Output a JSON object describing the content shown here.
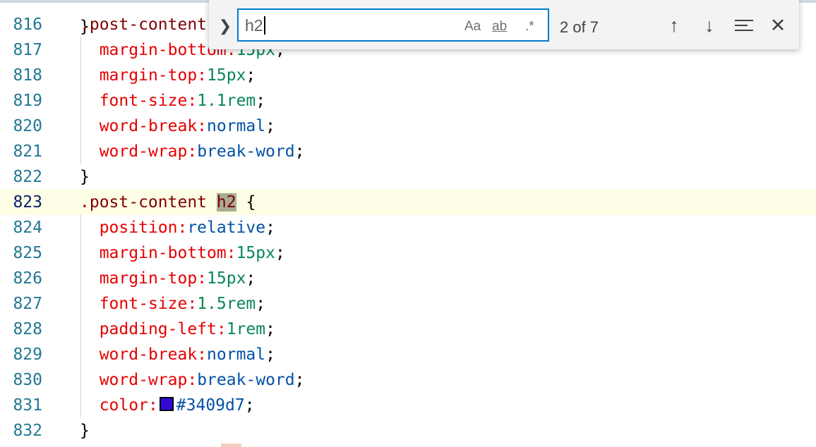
{
  "find_widget": {
    "toggle_icon": "chevron-right-icon",
    "query": "h2",
    "options": {
      "match_case": "Aa",
      "whole_word": "ab",
      "regex": ".*"
    },
    "match_count": "2 of 7",
    "buttons": {
      "previous": "arrow-up-icon",
      "next": "arrow-down-icon",
      "find_in_selection": "selection-lines-icon",
      "close": "close-icon"
    }
  },
  "editor": {
    "top_partial": "}",
    "lines": [
      {
        "num": "816",
        "code": ".post-content"
      },
      {
        "num": "817",
        "code": "margin-bottom:15px;"
      },
      {
        "num": "818",
        "code": "margin-top:15px;"
      },
      {
        "num": "819",
        "code": "font-size:1.1rem;"
      },
      {
        "num": "820",
        "code": "word-break:normal;"
      },
      {
        "num": "821",
        "code": "word-wrap:break-word;"
      },
      {
        "num": "822",
        "code": "}"
      },
      {
        "num": "823",
        "code": ".post-content h2 {"
      },
      {
        "num": "824",
        "code": "position:relative;"
      },
      {
        "num": "825",
        "code": "margin-bottom:15px;"
      },
      {
        "num": "826",
        "code": "margin-top:15px;"
      },
      {
        "num": "827",
        "code": "font-size:1.5rem;"
      },
      {
        "num": "828",
        "code": "padding-left:1rem;"
      },
      {
        "num": "829",
        "code": "word-break:normal;"
      },
      {
        "num": "830",
        "code": "word-wrap:break-word;"
      },
      {
        "num": "831",
        "code": "color:#3409d7;"
      },
      {
        "num": "832",
        "code": "}"
      }
    ],
    "swatch_color": "#3409d7",
    "colors": {
      "selector": "#800000",
      "property": "#e50000",
      "number": "#098658",
      "value": "#0451a5",
      "line_number": "#237893",
      "current_line_bg": "#fefee6",
      "match_highlight": "#a8ac94",
      "find_border": "#007acc"
    }
  }
}
